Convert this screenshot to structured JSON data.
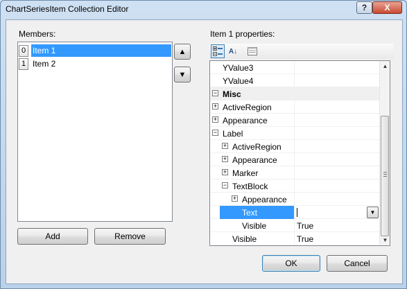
{
  "window": {
    "title": "ChartSeriesItem Collection Editor",
    "help_label": "?",
    "close_label": "X"
  },
  "members": {
    "label": "Members:",
    "items": [
      {
        "index": "0",
        "name": "Item 1",
        "selected": true
      },
      {
        "index": "1",
        "name": "Item 2",
        "selected": false
      }
    ],
    "move_up_icon": "▲",
    "move_down_icon": "▼",
    "add_label": "Add",
    "remove_label": "Remove"
  },
  "properties": {
    "label": "Item 1 properties:",
    "toolbar": {
      "categorized_icon": "categorized-icon",
      "alphabetical_icon": "alphabetical-icon",
      "alphabetical_glyph": "A↓",
      "property_pages_icon": "property-pages-icon"
    },
    "rows": [
      {
        "name": "YValue3",
        "value": ""
      },
      {
        "name": "YValue4",
        "value": ""
      },
      {
        "name": "Misc",
        "value": "",
        "category": true,
        "expander": "−"
      },
      {
        "name": "ActiveRegion",
        "value": "",
        "expander": "+"
      },
      {
        "name": "Appearance",
        "value": "",
        "expander": "+"
      },
      {
        "name": "Label",
        "value": "",
        "expander": "−"
      },
      {
        "name": "ActiveRegion",
        "value": "",
        "expander": "+"
      },
      {
        "name": "Appearance",
        "value": "",
        "expander": "+"
      },
      {
        "name": "Marker",
        "value": "",
        "expander": "+"
      },
      {
        "name": "TextBlock",
        "value": "",
        "expander": "−"
      },
      {
        "name": "Appearance",
        "value": "",
        "expander": "+"
      },
      {
        "name": "Text",
        "value": "",
        "selected": true
      },
      {
        "name": "Visible",
        "value": "True"
      },
      {
        "name": "Visible",
        "value": "True"
      }
    ],
    "dropdown_glyph": "▼",
    "scroll_up_glyph": "▲",
    "scroll_down_glyph": "▼"
  },
  "footer": {
    "ok_label": "OK",
    "cancel_label": "Cancel"
  },
  "colors": {
    "selection": "#3399ff",
    "window_chrome": "#cfe0f3",
    "close_button": "#c94a31"
  }
}
